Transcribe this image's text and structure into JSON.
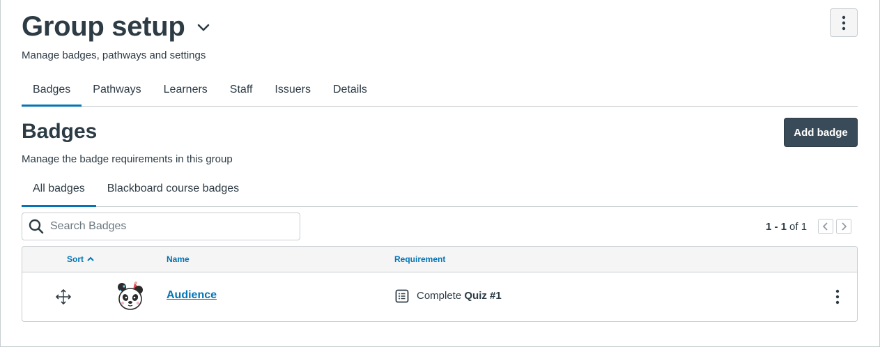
{
  "header": {
    "title": "Group setup",
    "subtitle": "Manage badges, pathways and settings",
    "menu_icon": "more-vertical-icon",
    "title_menu_icon": "chevron-down-icon"
  },
  "tabs": [
    {
      "label": "Badges",
      "active": true
    },
    {
      "label": "Pathways",
      "active": false
    },
    {
      "label": "Learners",
      "active": false
    },
    {
      "label": "Staff",
      "active": false
    },
    {
      "label": "Issuers",
      "active": false
    },
    {
      "label": "Details",
      "active": false
    }
  ],
  "section": {
    "title": "Badges",
    "subtitle": "Manage the badge requirements in this group",
    "add_button_label": "Add badge"
  },
  "subtabs": [
    {
      "label": "All badges",
      "active": true
    },
    {
      "label": "Blackboard course badges",
      "active": false
    }
  ],
  "search": {
    "placeholder": "Search Badges",
    "value": ""
  },
  "pagination": {
    "range": "1 - 1",
    "of_label": "of 1",
    "prev_icon": "chevron-left-icon",
    "next_icon": "chevron-right-icon"
  },
  "table": {
    "columns": {
      "sort": "Sort",
      "name": "Name",
      "requirement": "Requirement"
    },
    "rows": [
      {
        "name": "Audience",
        "requirement_prefix": "Complete",
        "requirement_item": "Quiz #1",
        "badge_icon": "panda-badge-image",
        "drag_icon": "move-arrows-icon",
        "requirement_icon": "list-icon"
      }
    ]
  },
  "colors": {
    "accent": "#0374b5",
    "text": "#2d3b45",
    "button_dark": "#394b58",
    "border": "#c7cdd1"
  }
}
